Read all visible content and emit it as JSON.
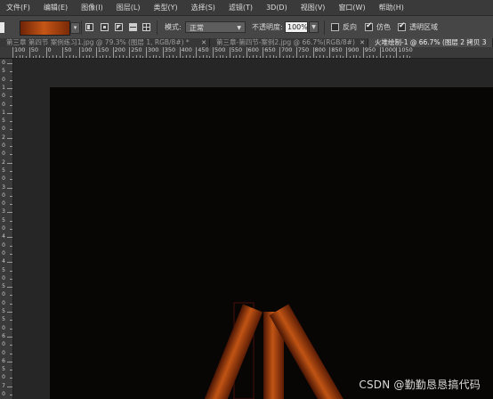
{
  "menu": [
    "文件(F)",
    "编辑(E)",
    "图像(I)",
    "图层(L)",
    "类型(Y)",
    "选择(S)",
    "滤镜(T)",
    "3D(D)",
    "视图(V)",
    "窗口(W)",
    "帮助(H)"
  ],
  "options": {
    "mode_label": "模式:",
    "mode_value": "正常",
    "opacity_label": "不透明度:",
    "opacity_value": "100%",
    "reverse_label": "反向",
    "dither_label": "仿色",
    "transparency_label": "透明区域",
    "gradient_colors": [
      "#6e2407",
      "#c55616",
      "#7a2a08"
    ]
  },
  "tabs": [
    {
      "label": "第三章 第四节 案例练习1.jpg @ 79.3% (图层 1, RGB/8#) *"
    },
    {
      "label": "第三章-第四节-案例2.jpg @ 66.7%(RGB/8#)"
    },
    {
      "label": "火堆绘制-1 @ 66.7% (图层 2 拷贝 3"
    }
  ],
  "ruler_h": [
    "100",
    "50",
    "0",
    "50",
    "100",
    "150",
    "200",
    "250",
    "300",
    "350",
    "400",
    "450",
    "500",
    "550",
    "600",
    "650",
    "700",
    "750",
    "800",
    "850",
    "900",
    "950",
    "1000",
    "1050"
  ],
  "ruler_v": [
    "0",
    "5",
    "0",
    "1",
    "0",
    "0",
    "1",
    "5",
    "0",
    "2",
    "0",
    "0",
    "2",
    "5",
    "0",
    "3",
    "0",
    "0",
    "3",
    "5",
    "0",
    "4",
    "0",
    "0",
    "4",
    "5",
    "0",
    "5",
    "0",
    "0",
    "5",
    "5",
    "0",
    "6",
    "0",
    "0",
    "6",
    "5",
    "0",
    "7",
    "0"
  ],
  "watermark": "CSDN @勤勤恳恳搞代码"
}
